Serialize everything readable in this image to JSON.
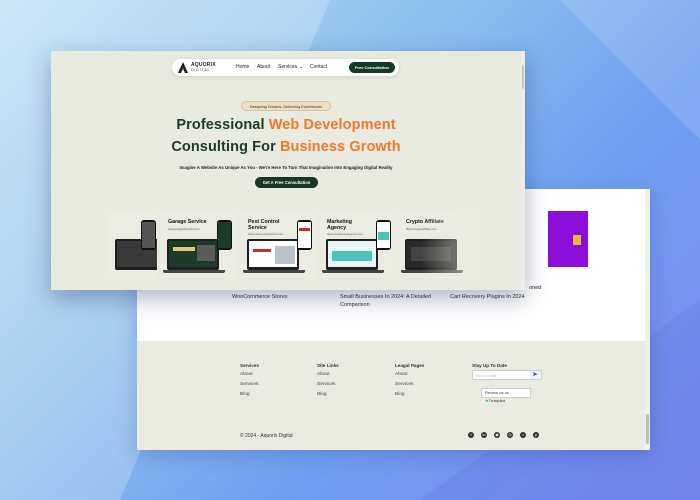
{
  "front": {
    "nav": {
      "logo_name": "AQUORIX",
      "logo_sub": "DIGITAL",
      "links": [
        "Home",
        "About",
        "Services",
        "Contact"
      ],
      "cta": "Free Consultation"
    },
    "hero": {
      "badge": "Designing Dreams, Delivering Experiences",
      "line1_prefix": "Professional ",
      "line1_accent": "Web Development",
      "line2_prefix": "Consulting For ",
      "line2_accent": "Business Growth",
      "subtitle": "Imagine A Website As Unique As You - We're Here To Turn That Imagination Into Engaging Digital Reality",
      "cta": "Get A Free Consultation"
    },
    "portfolio": [
      {
        "title": "Garage Service",
        "url": "www.garagesbrands.com"
      },
      {
        "title": "Pest Control Service",
        "url": "https://www.pestcontrol.com"
      },
      {
        "title": "Marketing Agency",
        "url": "https://marketingagency.com"
      },
      {
        "title": "Crypto Affiliate",
        "url": "https://cryptoaffiliate.com"
      }
    ]
  },
  "back": {
    "posts": [
      {
        "text": "WooCommerce Stores"
      },
      {
        "text": "Small Businesses In 2024: A Detailed Comparison"
      },
      {
        "text": "Cart Recovery Plugins In 2024"
      },
      {
        "text": "oned"
      }
    ],
    "footer": {
      "columns": [
        {
          "heading": "Services",
          "links": [
            "About",
            "Services",
            "Blog"
          ]
        },
        {
          "heading": "Site Links",
          "links": [
            "About",
            "Services",
            "Blog"
          ]
        },
        {
          "heading": "Leagal Pages",
          "links": [
            "About",
            "Services",
            "Blog"
          ]
        }
      ],
      "newsletter_heading": "Stay Up To Date",
      "email_placeholder": "Your e-mail",
      "trustpilot": "Review us on",
      "trustpilot_brand": "Trustpilot",
      "copyright": "© 2024 - Aquorix Digital",
      "social_icons": [
        "facebook-icon",
        "linkedin-icon",
        "whatsapp-icon",
        "instagram-icon",
        "twitter-icon",
        "pinterest-icon"
      ]
    }
  },
  "colors": {
    "accent": "#ef7a2c",
    "brand_dark": "#173826",
    "heading": "#1b3a2a",
    "bg": "#e8eadf",
    "purple": "#8a10d9"
  }
}
